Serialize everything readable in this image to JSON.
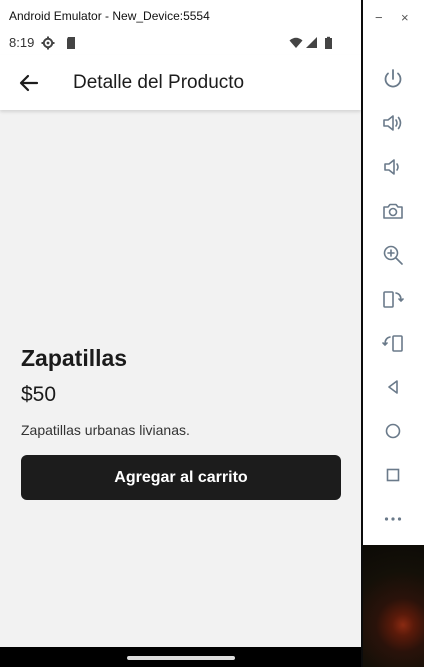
{
  "window": {
    "title": "Android Emulator - New_Device:5554"
  },
  "status_bar": {
    "time": "8:19"
  },
  "app_bar": {
    "title": "Detalle del Producto"
  },
  "product": {
    "name": "Zapatillas",
    "price": "$50",
    "description": "Zapatillas urbanas livianas.",
    "add_to_cart_label": "Agregar al carrito"
  },
  "window_controls": {
    "minimize": "−",
    "close": "×"
  },
  "toolbar": {
    "items": [
      {
        "icon": "power-icon"
      },
      {
        "icon": "volume-up-icon"
      },
      {
        "icon": "volume-down-icon"
      },
      {
        "icon": "camera-icon"
      },
      {
        "icon": "zoom-in-icon"
      },
      {
        "icon": "rotate-left-icon"
      },
      {
        "icon": "rotate-right-icon"
      },
      {
        "icon": "back-icon"
      },
      {
        "icon": "home-icon"
      },
      {
        "icon": "overview-icon"
      },
      {
        "icon": "more-icon"
      }
    ]
  }
}
